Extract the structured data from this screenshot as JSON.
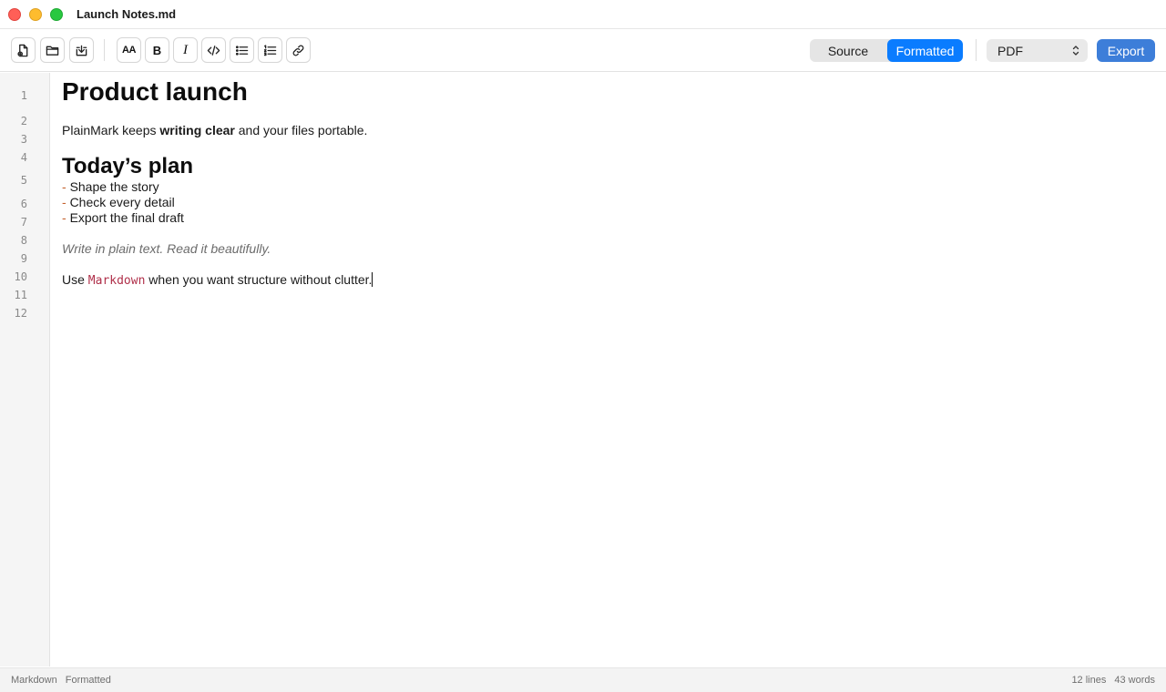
{
  "window": {
    "title": "Launch Notes.md"
  },
  "toolbar": {
    "buttons": [
      {
        "icon": "new-file-icon"
      },
      {
        "icon": "folder-icon"
      },
      {
        "icon": "save-download-icon"
      },
      {
        "icon": "font-size-icon",
        "glyph": "AA"
      },
      {
        "icon": "bold-icon",
        "glyph": "B"
      },
      {
        "icon": "italic-icon",
        "glyph": "I"
      },
      {
        "icon": "code-icon"
      },
      {
        "icon": "bullet-list-icon"
      },
      {
        "icon": "numbered-list-icon"
      },
      {
        "icon": "link-icon"
      }
    ],
    "view_mode": {
      "source_label": "Source",
      "formatted_label": "Formatted",
      "selected": "Formatted"
    },
    "export_format": {
      "selected": "PDF"
    },
    "export_label": "Export"
  },
  "editor": {
    "line_numbers": [
      "1",
      "2",
      "3",
      "4",
      "5",
      "6",
      "7",
      "8",
      "9",
      "10",
      "11",
      "12"
    ],
    "heading1": "Product launch",
    "para1": {
      "before": "PlainMark keeps ",
      "bold": "writing clear",
      "after": " and your files portable."
    },
    "heading2": "Today’s plan",
    "list_marker": "-",
    "list": [
      "Shape the story",
      "Check every detail",
      "Export the final draft"
    ],
    "emphasis": "Write in plain text. Read it beautifully.",
    "para2": {
      "before": "Use ",
      "code": "Markdown",
      "after": " when you want structure without clutter."
    }
  },
  "status": {
    "language": "Markdown",
    "mode": "Formatted",
    "lines": "12 lines",
    "words": "43 words"
  },
  "colors": {
    "accent": "#0a7cff",
    "export_button": "#3d7ed9",
    "list_marker": "#c4612e",
    "inline_code": "#b0304a"
  }
}
